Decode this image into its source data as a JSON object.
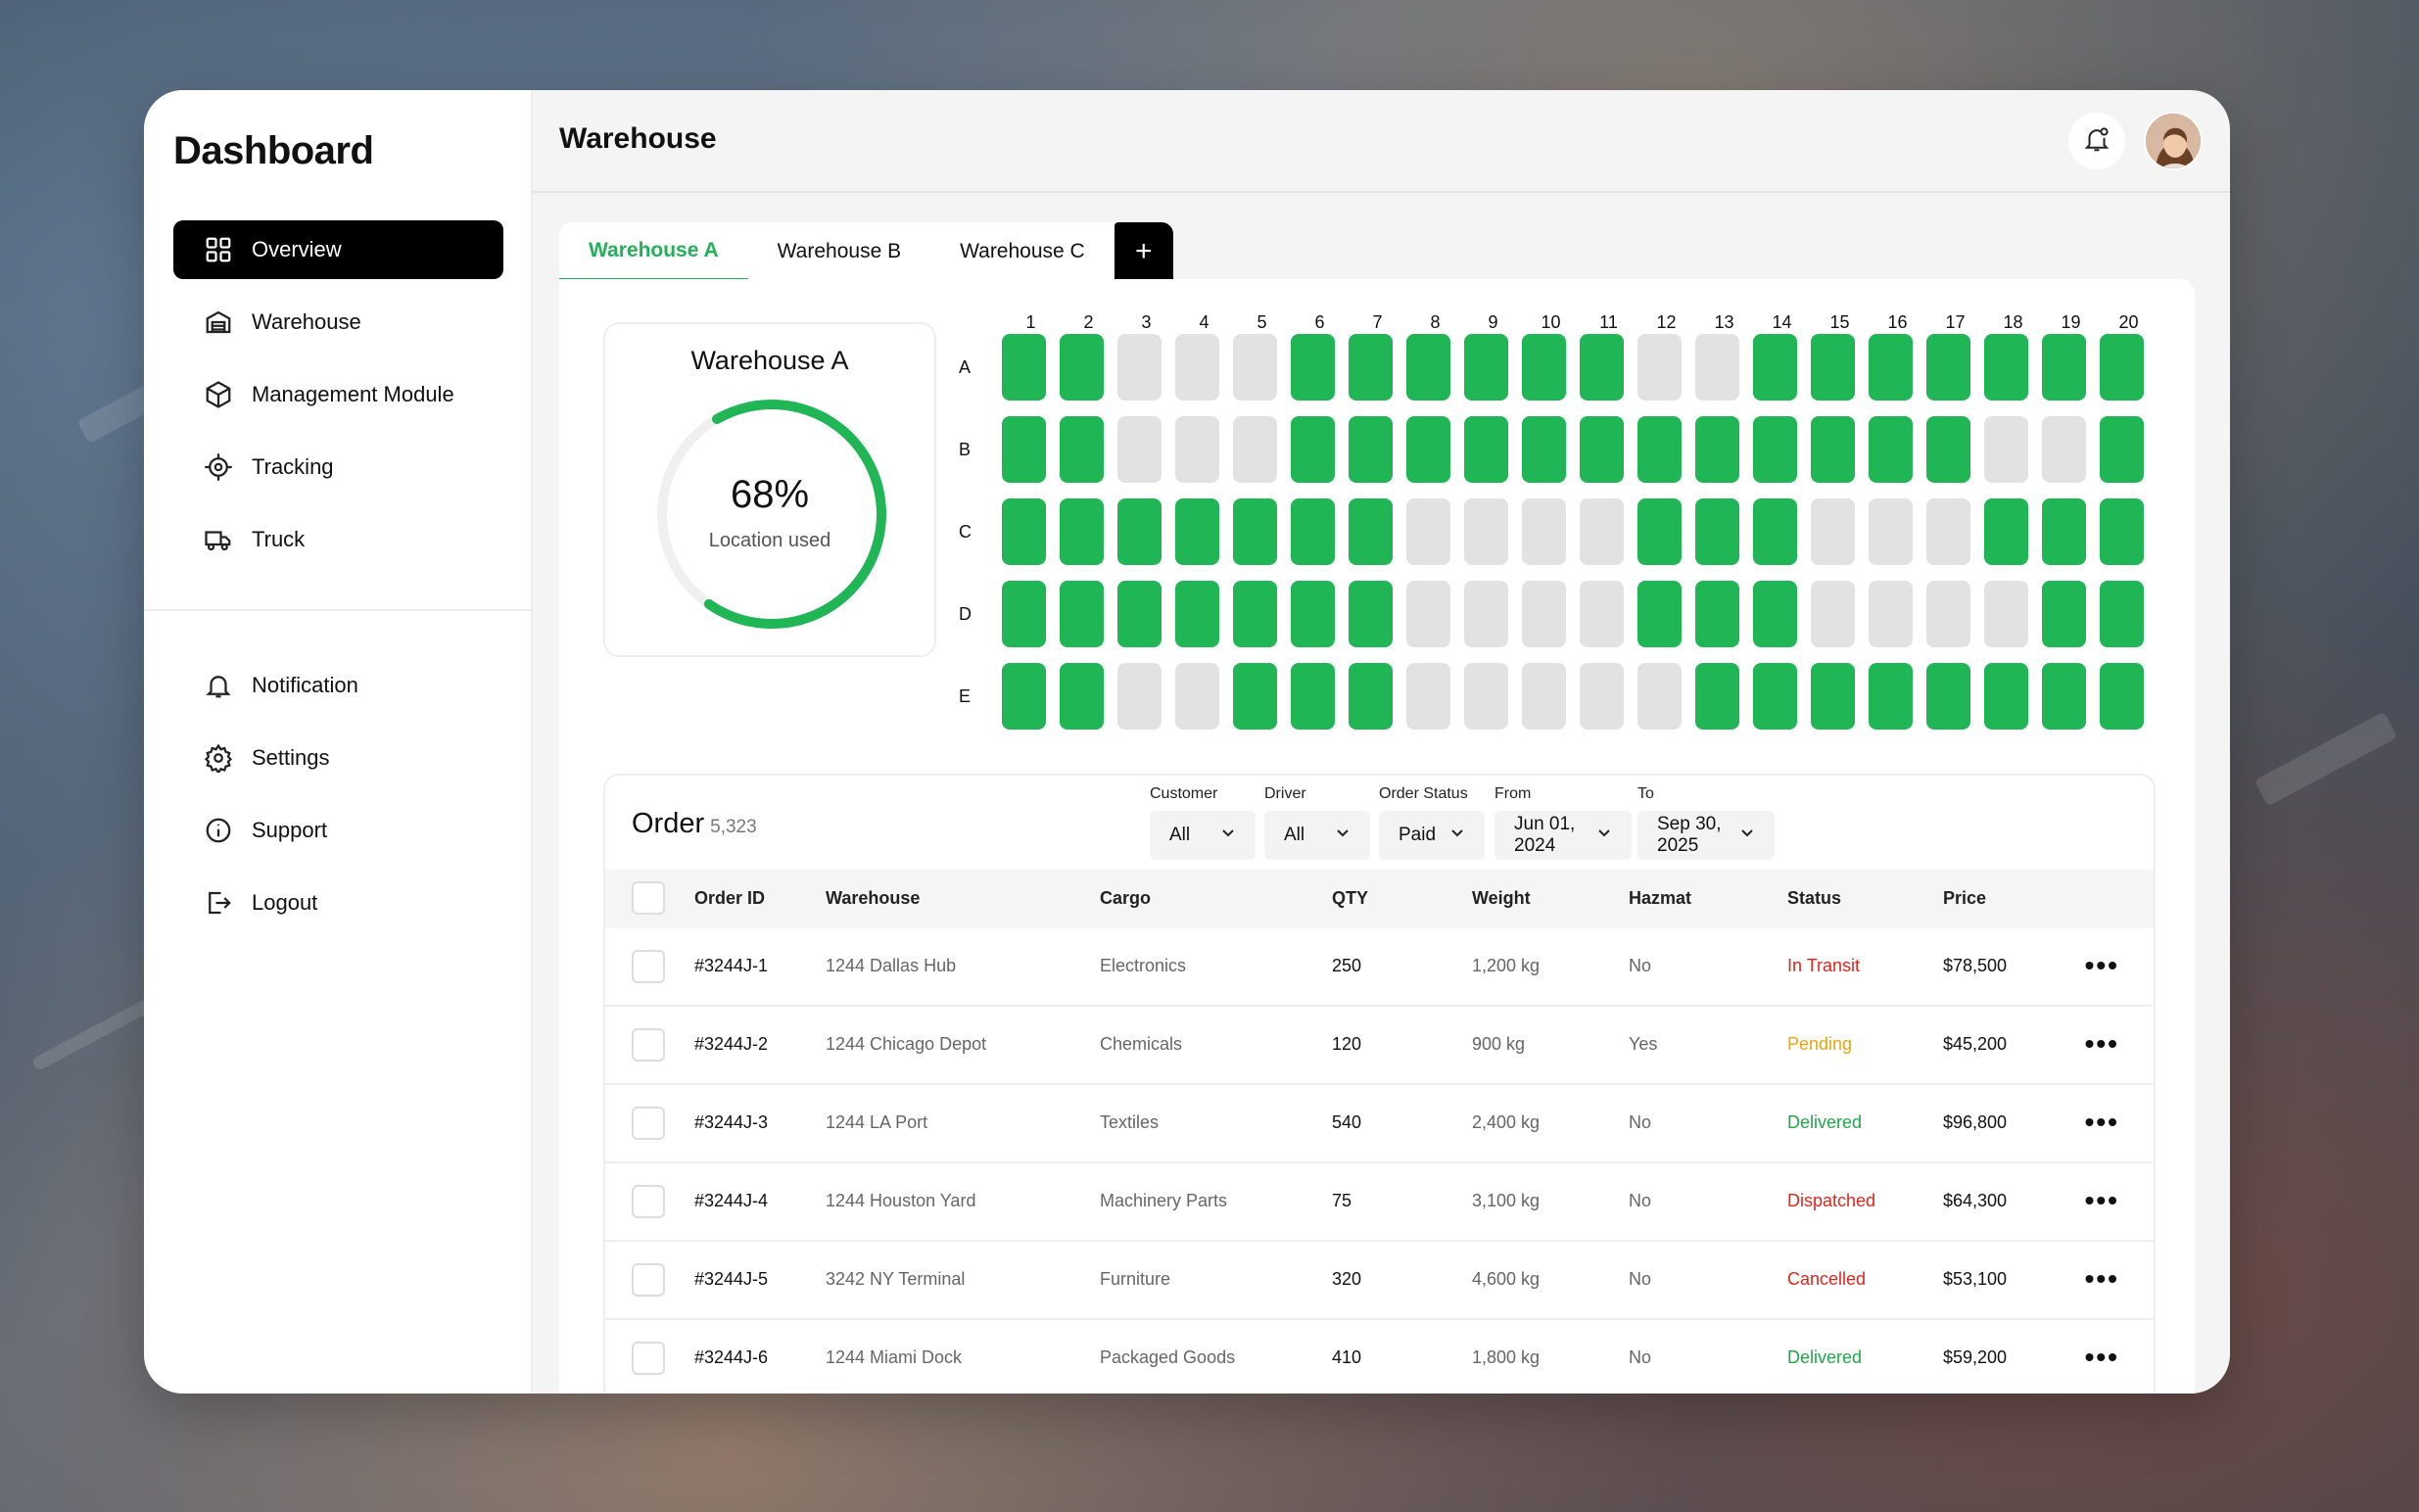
{
  "sidebar": {
    "brand": "Dashboard",
    "nav": [
      {
        "label": "Overview",
        "icon": "grid-icon"
      },
      {
        "label": "Warehouse",
        "icon": "warehouse-icon"
      },
      {
        "label": "Management Module",
        "icon": "box-icon"
      },
      {
        "label": "Tracking",
        "icon": "crosshair-icon"
      },
      {
        "label": "Truck",
        "icon": "truck-icon"
      }
    ],
    "nav2": [
      {
        "label": "Notification",
        "icon": "bell-icon"
      },
      {
        "label": "Settings",
        "icon": "gear-icon"
      },
      {
        "label": "Support",
        "icon": "info-icon"
      },
      {
        "label": "Logout",
        "icon": "logout-icon"
      }
    ]
  },
  "header": {
    "title": "Warehouse"
  },
  "tabs": [
    "Warehouse A",
    "Warehouse B",
    "Warehouse C"
  ],
  "tab_add": "+",
  "gauge": {
    "title": "Warehouse A",
    "percent_text": "68%",
    "percent": 0.68,
    "label": "Location used"
  },
  "grid": {
    "columns": [
      "1",
      "2",
      "3",
      "4",
      "5",
      "6",
      "7",
      "8",
      "9",
      "10",
      "11",
      "12",
      "13",
      "14",
      "15",
      "16",
      "17",
      "18",
      "19",
      "20"
    ],
    "rows": [
      {
        "label": "A",
        "cells": [
          1,
          1,
          0,
          0,
          0,
          1,
          1,
          1,
          1,
          1,
          1,
          0,
          0,
          1,
          1,
          1,
          1,
          1,
          1,
          1
        ]
      },
      {
        "label": "B",
        "cells": [
          1,
          1,
          0,
          0,
          0,
          1,
          1,
          1,
          1,
          1,
          1,
          1,
          1,
          1,
          1,
          1,
          1,
          0,
          0,
          1
        ]
      },
      {
        "label": "C",
        "cells": [
          1,
          1,
          1,
          1,
          1,
          1,
          1,
          0,
          0,
          0,
          0,
          1,
          1,
          1,
          0,
          0,
          0,
          1,
          1,
          1
        ]
      },
      {
        "label": "D",
        "cells": [
          1,
          1,
          1,
          1,
          1,
          1,
          1,
          0,
          0,
          0,
          0,
          1,
          1,
          1,
          0,
          0,
          0,
          0,
          1,
          1
        ]
      },
      {
        "label": "E",
        "cells": [
          1,
          1,
          0,
          0,
          1,
          1,
          1,
          0,
          0,
          0,
          0,
          0,
          1,
          1,
          1,
          1,
          1,
          1,
          1,
          1
        ]
      }
    ]
  },
  "orders": {
    "title": "Order",
    "count": "5,323",
    "filters": [
      {
        "label": "Customer",
        "value": "All"
      },
      {
        "label": "Driver",
        "value": "All"
      },
      {
        "label": "Order Status",
        "value": "Paid"
      },
      {
        "label": "From",
        "value": "Jun 01, 2024"
      },
      {
        "label": "To",
        "value": "Sep 30, 2025"
      }
    ],
    "columns": [
      "Order ID",
      "Warehouse",
      "Cargo",
      "QTY",
      "Weight",
      "Hazmat",
      "Status",
      "Price"
    ],
    "rows": [
      {
        "id": "#3244J-1",
        "warehouse": "1244 Dallas Hub",
        "cargo": "Electronics",
        "qty": "250",
        "weight": "1,200 kg",
        "hazmat": "No",
        "status": "In Transit",
        "price": "$78,500"
      },
      {
        "id": "#3244J-2",
        "warehouse": "1244 Chicago Depot",
        "cargo": "Chemicals",
        "qty": "120",
        "weight": "900 kg",
        "hazmat": "Yes",
        "status": "Pending",
        "price": "$45,200"
      },
      {
        "id": "#3244J-3",
        "warehouse": "1244 LA Port",
        "cargo": "Textiles",
        "qty": "540",
        "weight": "2,400 kg",
        "hazmat": "No",
        "status": "Delivered",
        "price": "$96,800"
      },
      {
        "id": "#3244J-4",
        "warehouse": "1244 Houston Yard",
        "cargo": "Machinery Parts",
        "qty": "75",
        "weight": "3,100 kg",
        "hazmat": "No",
        "status": "Dispatched",
        "price": "$64,300"
      },
      {
        "id": "#3244J-5",
        "warehouse": "3242 NY Terminal",
        "cargo": "Furniture",
        "qty": "320",
        "weight": "4,600 kg",
        "hazmat": "No",
        "status": "Cancelled",
        "price": "$53,100"
      },
      {
        "id": "#3244J-6",
        "warehouse": "1244 Miami Dock",
        "cargo": "Packaged Goods",
        "qty": "410",
        "weight": "1,800 kg",
        "hazmat": "No",
        "status": "Delivered",
        "price": "$59,200"
      }
    ],
    "status_colors": {
      "In Transit": "#e0261b",
      "Pending": "#e8a50c",
      "Delivered": "#1fa84a",
      "Dispatched": "#e0261b",
      "Cancelled": "#e0261b"
    }
  },
  "colors": {
    "accent": "#20b656",
    "empty": "#e2e2e2",
    "active_nav": "#000000"
  }
}
